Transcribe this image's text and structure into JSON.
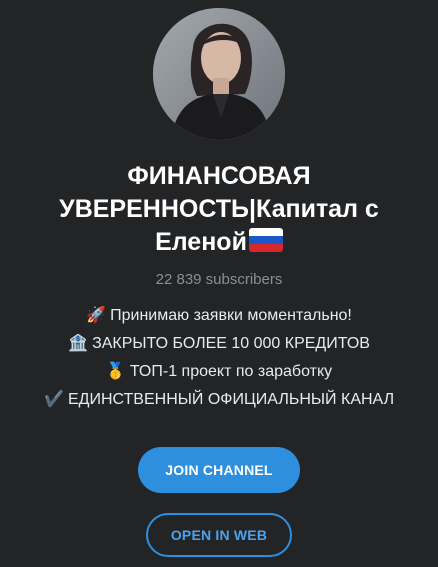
{
  "channel": {
    "title": "ФИНАНСОВАЯ УВЕРЕННОСТЬ|Капитал с Еленой",
    "title_flag": "ru-flag-icon",
    "subscribers": "22 839 subscribers",
    "description": [
      {
        "icon": "rocket-icon",
        "glyph": "🚀",
        "text": "Принимаю заявки моментально!"
      },
      {
        "icon": "bank-icon",
        "glyph": "🏦",
        "text": "ЗАКРЫТО БОЛЕЕ 10 000 КРЕДИТОВ"
      },
      {
        "icon": "gold-medal-icon",
        "glyph": "🥇",
        "text": "ТОП-1 проект по заработку"
      },
      {
        "icon": "check-mark-icon",
        "glyph": "✔️",
        "text": "ЕДИНСТВЕННЫЙ ОФИЦИАЛЬНЫЙ КАНАЛ"
      }
    ]
  },
  "buttons": {
    "join": "JOIN CHANNEL",
    "open_web": "OPEN IN WEB"
  },
  "colors": {
    "background": "#232426",
    "accent": "#2e8fdf",
    "subtitle": "#8c8d90"
  }
}
